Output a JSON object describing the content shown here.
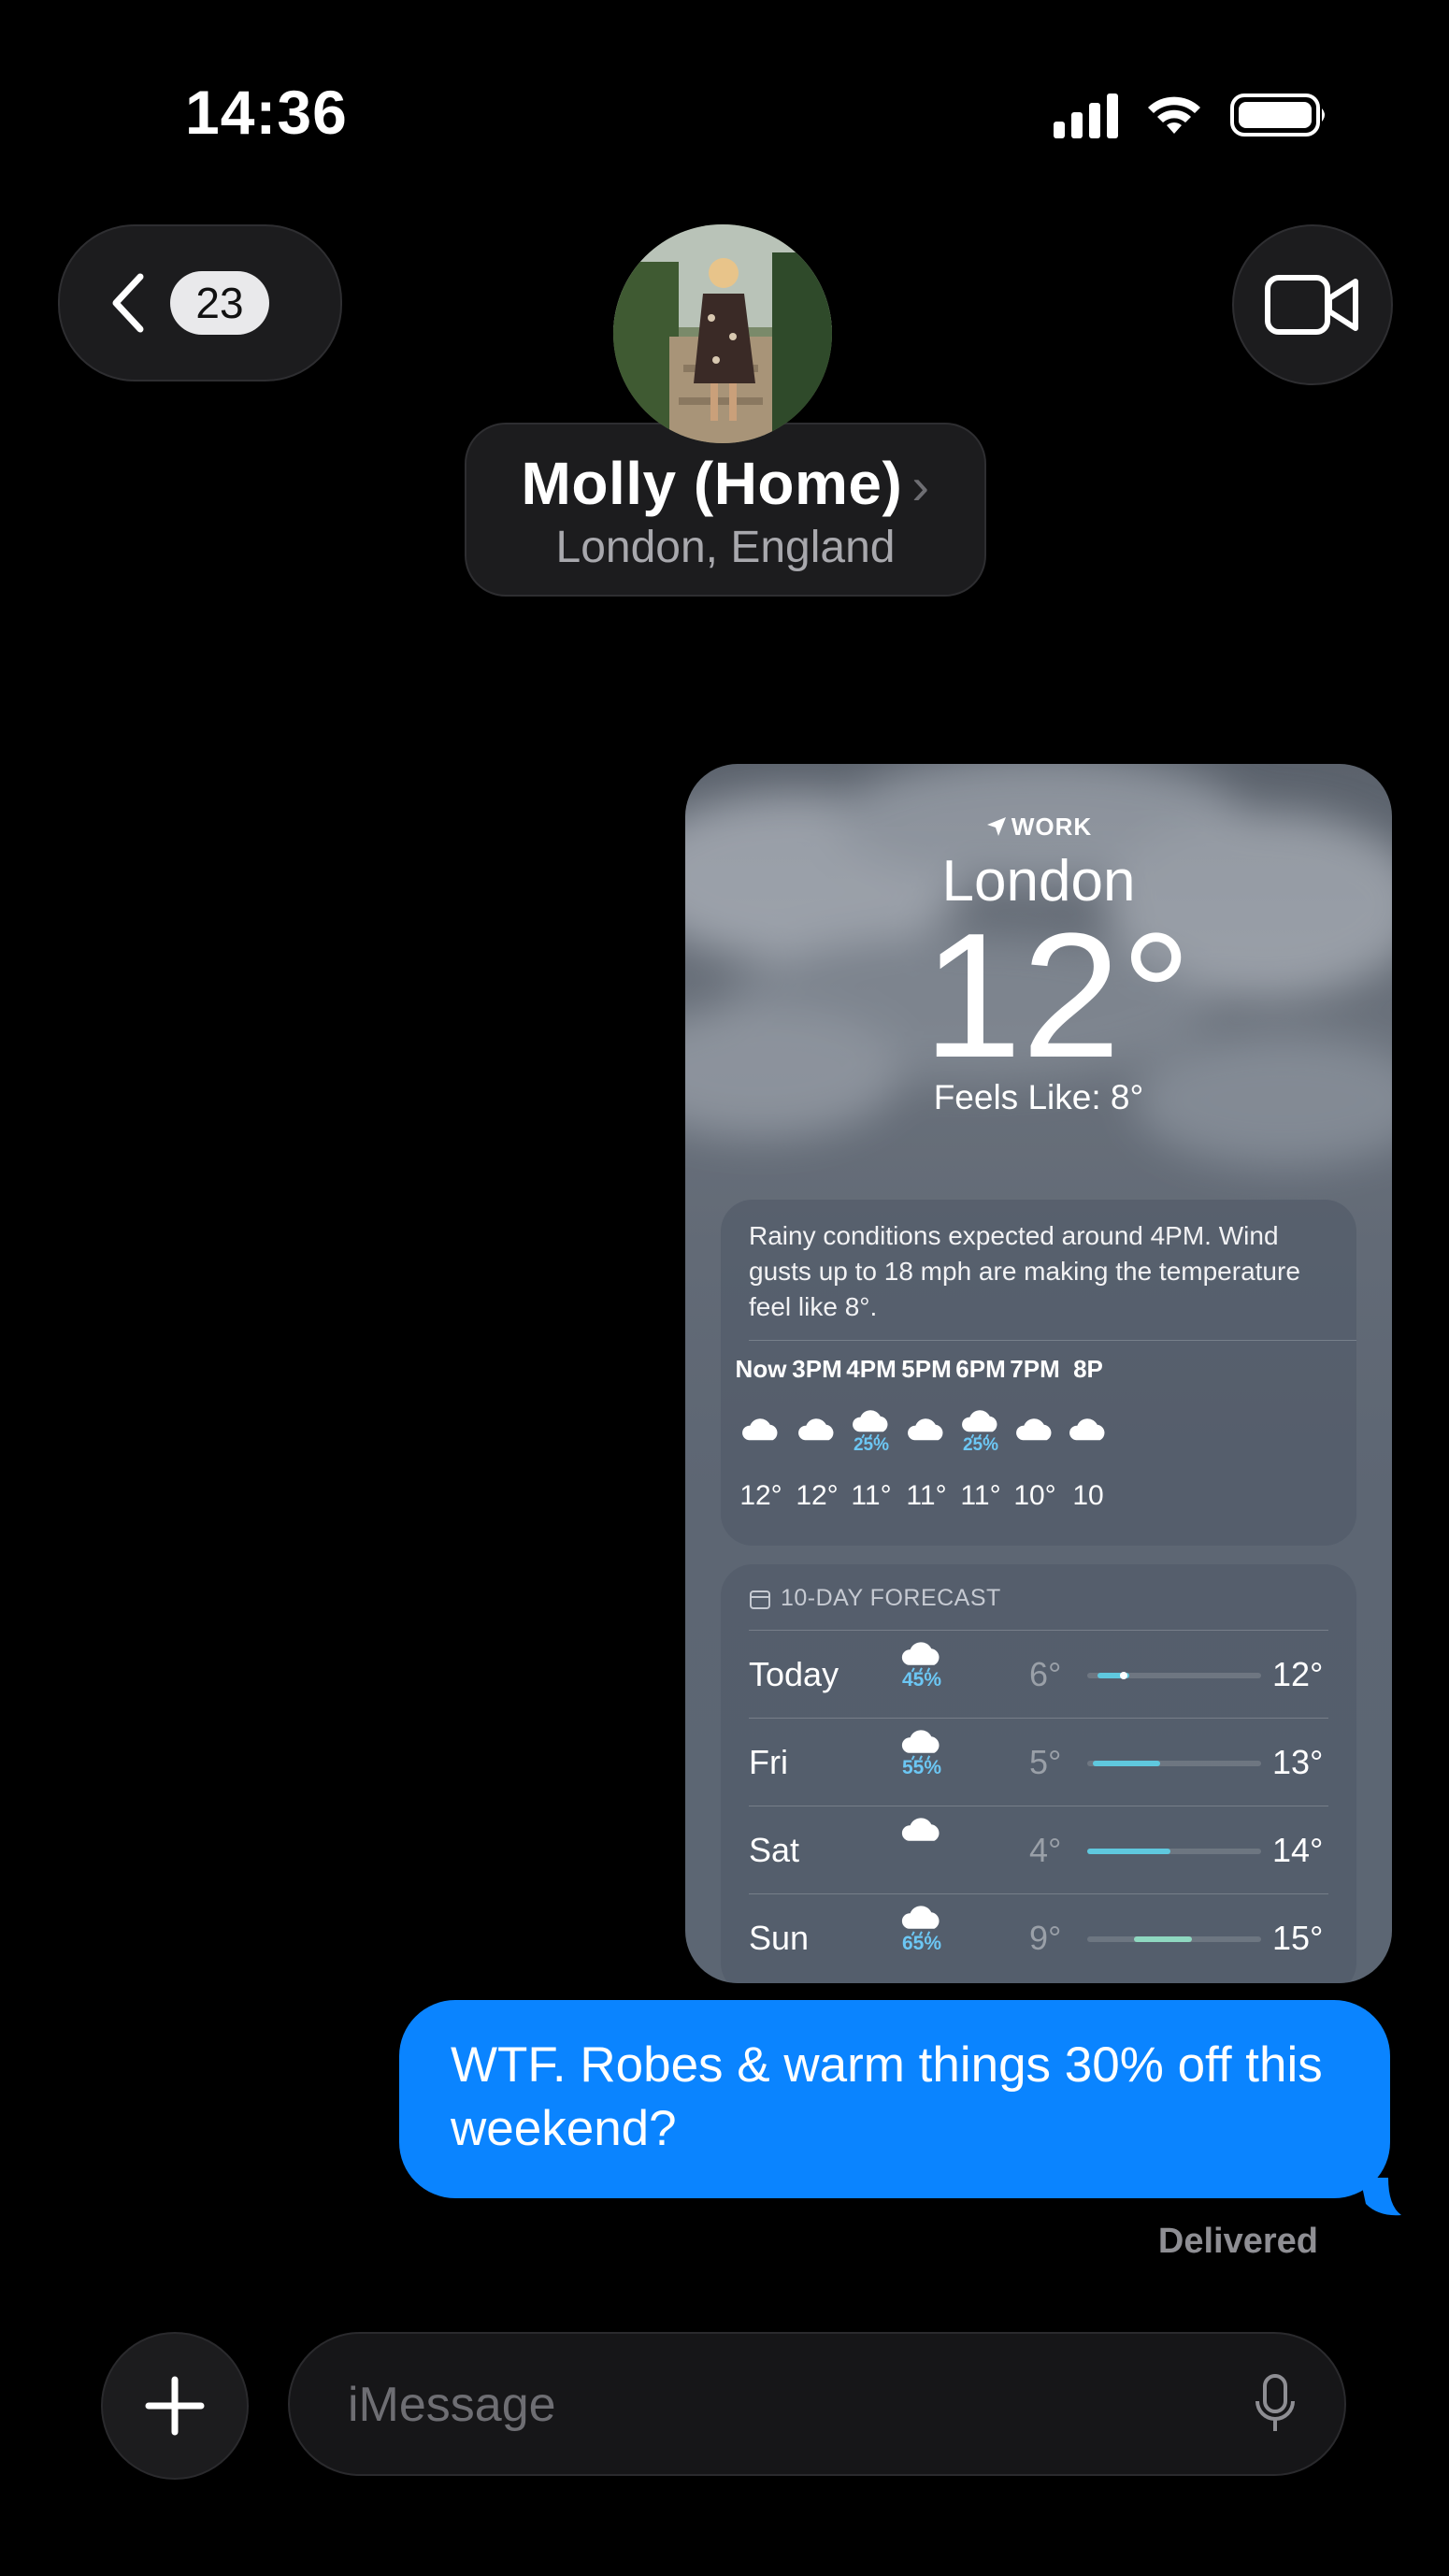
{
  "status_bar": {
    "time": "14:36",
    "icons": [
      "cellular-signal-icon",
      "wifi-icon",
      "battery-icon"
    ]
  },
  "header": {
    "back_badge": "23",
    "contact_name": "Molly (Home)",
    "contact_location": "London, England",
    "icons": [
      "chevron-left-icon",
      "video-camera-icon",
      "chevron-right-icon"
    ]
  },
  "weather": {
    "location_tag": "WORK",
    "city": "London",
    "temperature": "12°",
    "feels_like": "Feels Like: 8°",
    "summary": "Rainy conditions expected around 4PM. Wind gusts up to 18 mph are making the temperature feel like 8°.",
    "hourly": [
      {
        "label": "Now",
        "icon": "cloud-icon",
        "precip": "",
        "temp": "12°"
      },
      {
        "label": "3PM",
        "icon": "cloud-icon",
        "precip": "",
        "temp": "12°"
      },
      {
        "label": "4PM",
        "icon": "cloud-rain-icon",
        "precip": "25%",
        "temp": "11°"
      },
      {
        "label": "5PM",
        "icon": "cloud-icon",
        "precip": "",
        "temp": "11°"
      },
      {
        "label": "6PM",
        "icon": "cloud-rain-icon",
        "precip": "25%",
        "temp": "11°"
      },
      {
        "label": "7PM",
        "icon": "cloud-icon",
        "precip": "",
        "temp": "10°"
      },
      {
        "label": "8P",
        "icon": "cloud-icon",
        "precip": "",
        "temp": "10"
      }
    ],
    "forecast_title": "10-DAY FORECAST",
    "daily": [
      {
        "day": "Today",
        "icon": "cloud-rain-icon",
        "precip": "45%",
        "low": "6°",
        "high": "12°",
        "range_start": 0.06,
        "range_end": 0.24,
        "current": 0.21,
        "color": "#5fc8de"
      },
      {
        "day": "Fri",
        "icon": "cloud-rain-icon",
        "precip": "55%",
        "low": "5°",
        "high": "13°",
        "range_start": 0.03,
        "range_end": 0.42,
        "color": "#5fc8de"
      },
      {
        "day": "Sat",
        "icon": "cloud-icon",
        "precip": "",
        "low": "4°",
        "high": "14°",
        "range_start": 0.0,
        "range_end": 0.48,
        "color": "#5fc8de"
      },
      {
        "day": "Sun",
        "icon": "cloud-rain-icon",
        "precip": "65%",
        "low": "9°",
        "high": "15°",
        "range_start": 0.27,
        "range_end": 0.6,
        "color": "#8fd8c0"
      }
    ]
  },
  "message": {
    "text": "WTF. Robes & warm things 30% off this weekend?",
    "status": "Delivered"
  },
  "composer": {
    "placeholder": "iMessage",
    "icons": [
      "plus-icon",
      "microphone-icon"
    ]
  },
  "colors": {
    "bubble": "#0a84ff",
    "precip": "#6cc7f4",
    "background": "#000000"
  }
}
